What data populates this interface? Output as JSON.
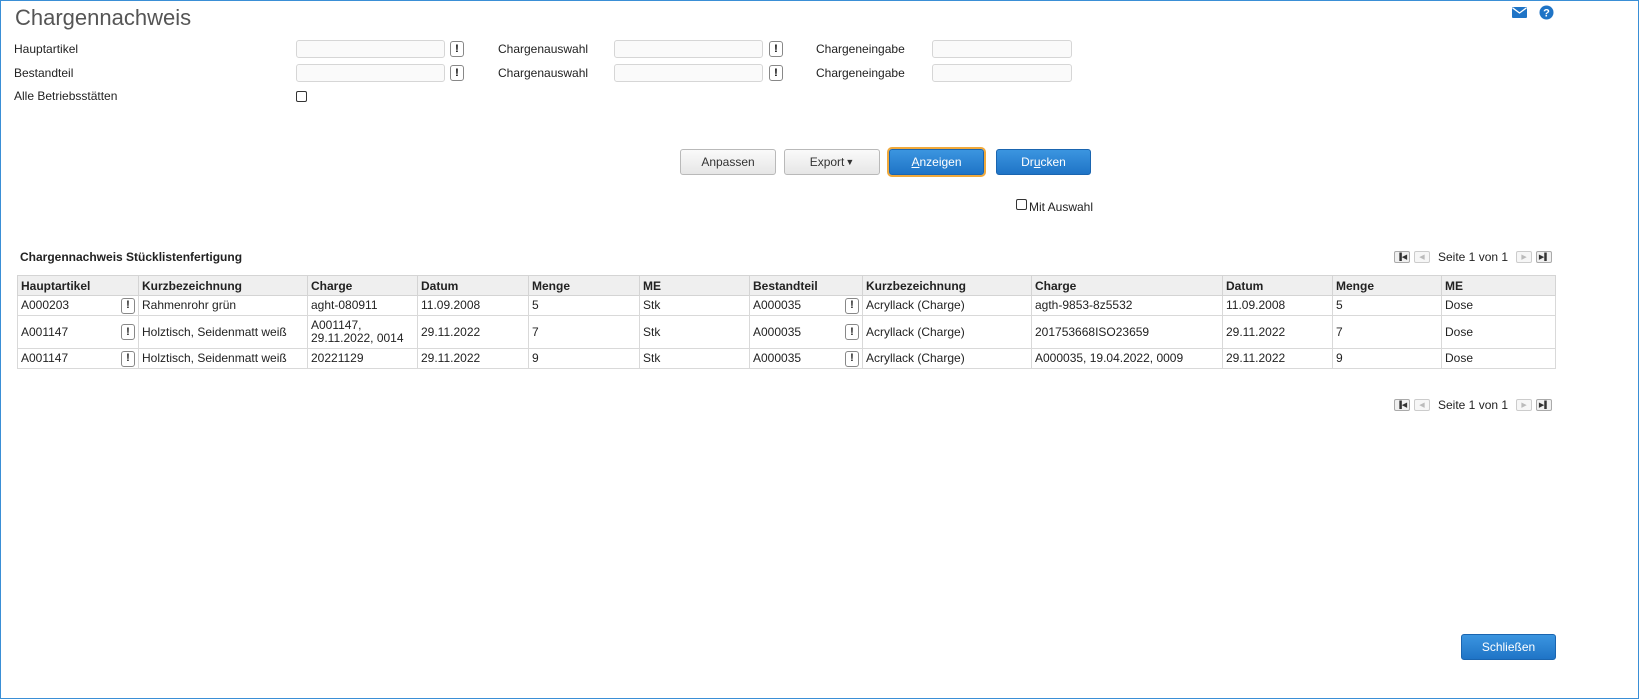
{
  "header": {
    "title": "Chargennachweis",
    "icons": [
      "mail-icon",
      "help-icon"
    ]
  },
  "filters": {
    "hauptartikel_label": "Hauptartikel",
    "hauptartikel_value": "",
    "bestandteil_label": "Bestandteil",
    "bestandteil_value": "",
    "chargenauswahl1_label": "Chargenauswahl",
    "chargenauswahl1_value": "",
    "chargenauswahl2_label": "Chargenauswahl",
    "chargenauswahl2_value": "",
    "chargeneingabe1_label": "Chargeneingabe",
    "chargeneingabe1_value": "",
    "chargeneingabe2_label": "Chargeneingabe",
    "chargeneingabe2_value": "",
    "alle_label": "Alle Betriebsstätten",
    "exclamation": "!"
  },
  "toolbar": {
    "anpassen": "Anpassen",
    "export": "Export",
    "anzeigen_first": "A",
    "anzeigen_rest": "nzeigen",
    "drucken_pre": "Dr",
    "drucken_u": "u",
    "drucken_post": "cken",
    "mit_auswahl": "Mit Auswahl"
  },
  "section": {
    "title": "Chargennachweis Stücklistenfertigung",
    "pager_text": "Seite 1 von 1"
  },
  "table": {
    "columns": [
      "Hauptartikel",
      "Kurzbezeichnung",
      "Charge",
      "Datum",
      "Menge",
      "ME",
      "Bestandteil",
      "Kurzbezeichnung",
      "Charge",
      "Datum",
      "Menge",
      "ME"
    ],
    "rows": [
      [
        "A000203",
        "Rahmenrohr grün",
        "aght-080911",
        "11.09.2008",
        "5",
        "Stk",
        "A000035",
        "Acryllack (Charge)",
        "agth-9853-8z5532",
        "11.09.2008",
        "5",
        "Dose"
      ],
      [
        "A001147",
        "Holztisch, Seidenmatt weiß",
        "A001147,\n29.11.2022, 0014",
        "29.11.2022",
        "7",
        "Stk",
        "A000035",
        "Acryllack (Charge)",
        "201753668ISO23659",
        "29.11.2022",
        "7",
        "Dose"
      ],
      [
        "A001147",
        "Holztisch, Seidenmatt weiß",
        "20221129",
        "29.11.2022",
        "9",
        "Stk",
        "A000035",
        "Acryllack (Charge)",
        "A000035, 19.04.2022, 0009",
        "29.11.2022",
        "9",
        "Dose"
      ]
    ]
  },
  "footer": {
    "close": "Schließen"
  }
}
